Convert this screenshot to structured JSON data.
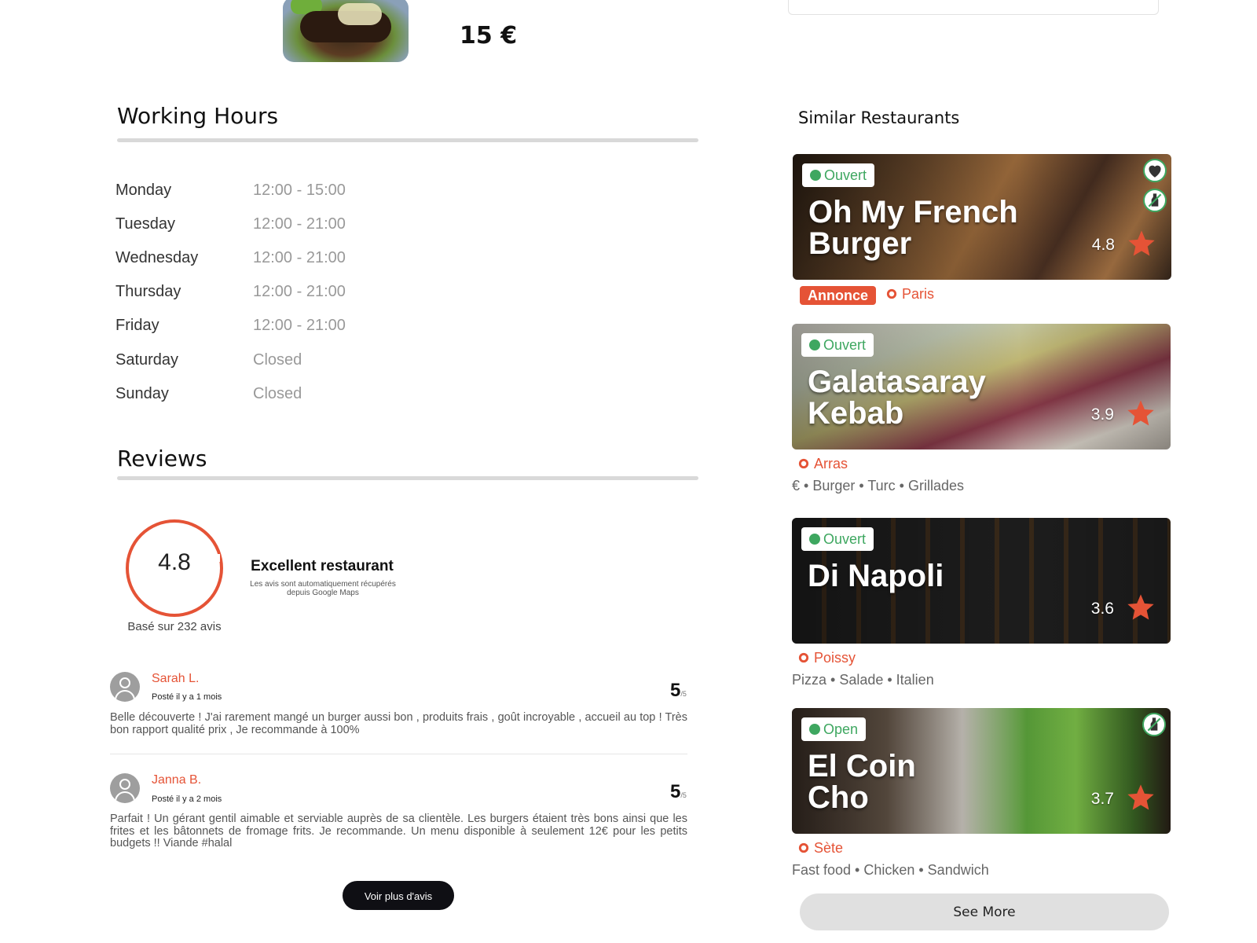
{
  "product": {
    "price": "15 €"
  },
  "working_hours": {
    "title": "Working Hours",
    "rows": [
      {
        "day": "Monday",
        "time": "12:00 - 15:00"
      },
      {
        "day": "Tuesday",
        "time": "12:00 - 21:00"
      },
      {
        "day": "Wednesday",
        "time": "12:00 - 21:00"
      },
      {
        "day": "Thursday",
        "time": "12:00 - 21:00"
      },
      {
        "day": "Friday",
        "time": "12:00 - 21:00"
      },
      {
        "day": "Saturday",
        "time": "Closed"
      },
      {
        "day": "Sunday",
        "time": "Closed"
      }
    ]
  },
  "reviews": {
    "title": "Reviews",
    "rating": "4.8",
    "based_on": "Basé sur 232 avis",
    "headline": "Excellent restaurant",
    "note": "Les avis sont automatiquement récupérés depuis Google Maps",
    "items": [
      {
        "name": "Sarah L.",
        "posted": "Posté il y a 1 mois",
        "score": "5",
        "scale": "/5",
        "text": "Belle découverte ! J'ai rarement mangé un burger aussi bon , produits frais , goût incroyable , accueil au top ! Très bon rapport qualité prix , Je recommande à 100%"
      },
      {
        "name": "Janna B.",
        "posted": "Posté il y a 2 mois",
        "score": "5",
        "scale": "/5",
        "text": "Parfait ! Un gérant gentil aimable et serviable auprès de sa clientèle. Les burgers étaient très bons ainsi que les frites et les bâtonnets de fromage frits. Je recommande. Un menu disponible à seulement 12€ pour les petits budgets !! Viande #halal"
      }
    ],
    "more_label": "Voir plus d'avis"
  },
  "similar": {
    "title": "Similar Restaurants",
    "see_more": "See More",
    "restaurants": [
      {
        "status": "Ouvert",
        "name": "Oh My French Burger",
        "rating": "4.8",
        "ad": "Annonce",
        "city": "Paris",
        "tags": ""
      },
      {
        "status": "Ouvert",
        "name": "Galatasaray Kebab",
        "rating": "3.9",
        "city": "Arras",
        "tags": "€  • Burger  •  Turc  •  Grillades"
      },
      {
        "status": "Ouvert",
        "name": "Di Napoli",
        "rating": "3.6",
        "city": "Poissy",
        "tags": "Pizza  • Salade  •  Italien"
      },
      {
        "status": "Open",
        "name": "El Coin Cho",
        "rating": "3.7",
        "city": "Sète",
        "tags": "Fast food  • Chicken  •  Sandwich"
      }
    ]
  },
  "colors": {
    "accent": "#e55336",
    "open_green": "#3ea760",
    "dark_button": "#0f0f14"
  }
}
